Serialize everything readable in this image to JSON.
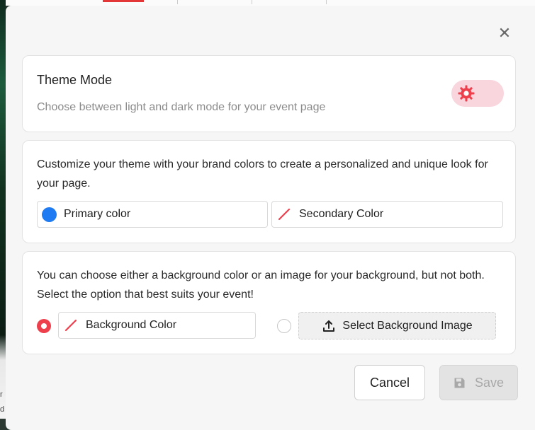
{
  "backdrop": {
    "left_text_1": "r",
    "left_text_2": "d"
  },
  "dialog": {
    "close_icon": "close-icon"
  },
  "theme_mode": {
    "title": "Theme Mode",
    "description": "Choose between light and dark mode for your event page",
    "toggle_icon": "sun-icon",
    "toggle_color": "#f9d5dd",
    "icon_color": "#ee3f4d"
  },
  "brand_colors": {
    "description": "Customize your theme with your brand colors to create a personalized and unique look for your page.",
    "primary_label": "Primary color",
    "primary_swatch": "#1f7bf2",
    "secondary_label": "Secondary Color",
    "secondary_swatch_icon": "no-color-slash-icon"
  },
  "background": {
    "description": "You can choose either a background color or an image for your background, but not both. Select the option that best suits your event!",
    "color_option_selected": true,
    "color_label": "Background Color",
    "image_option_selected": false,
    "image_button_label": "Select Background Image",
    "upload_icon": "upload-icon",
    "accent": "#ee3f4d"
  },
  "footer": {
    "cancel_label": "Cancel",
    "save_label": "Save",
    "save_icon": "floppy-disk-icon",
    "save_disabled": true
  }
}
